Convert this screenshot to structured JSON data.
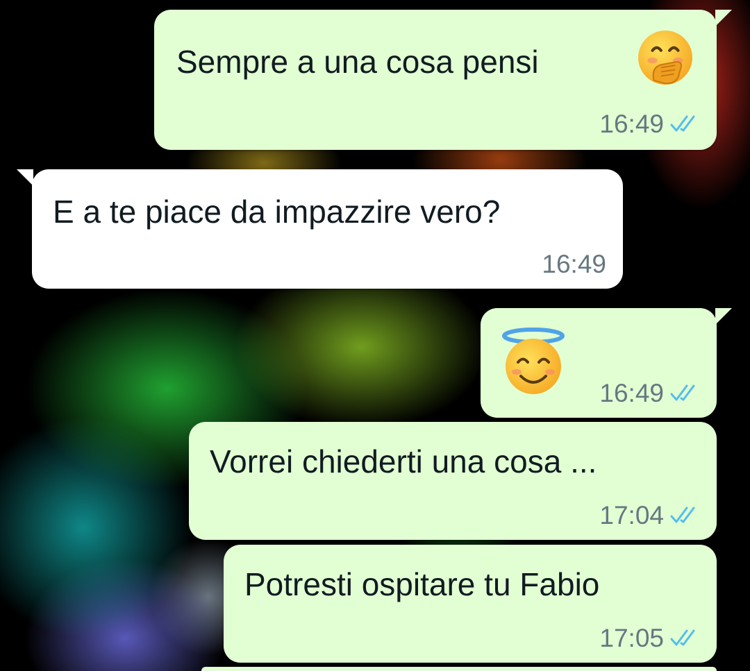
{
  "colors": {
    "outgoing_bubble": "#e2ffd3",
    "incoming_bubble": "#ffffff",
    "timestamp": "#667781",
    "read_ticks": "#53bdeb"
  },
  "messages": [
    {
      "direction": "outgoing",
      "text": "Sempre a una cosa pensi",
      "emoji": "face-with-hand-over-mouth-icon",
      "time": "16:49",
      "status": "read"
    },
    {
      "direction": "incoming",
      "text": "E a te piace da impazzire vero?",
      "time": "16:49"
    },
    {
      "direction": "outgoing",
      "emoji": "smiling-face-with-halo-icon",
      "time": "16:49",
      "status": "read"
    },
    {
      "direction": "outgoing",
      "text": "Vorrei chiederti una cosa ...",
      "time": "17:04",
      "status": "read"
    },
    {
      "direction": "outgoing",
      "text": "Potresti ospitare tu Fabio",
      "time": "17:05",
      "status": "read"
    }
  ]
}
